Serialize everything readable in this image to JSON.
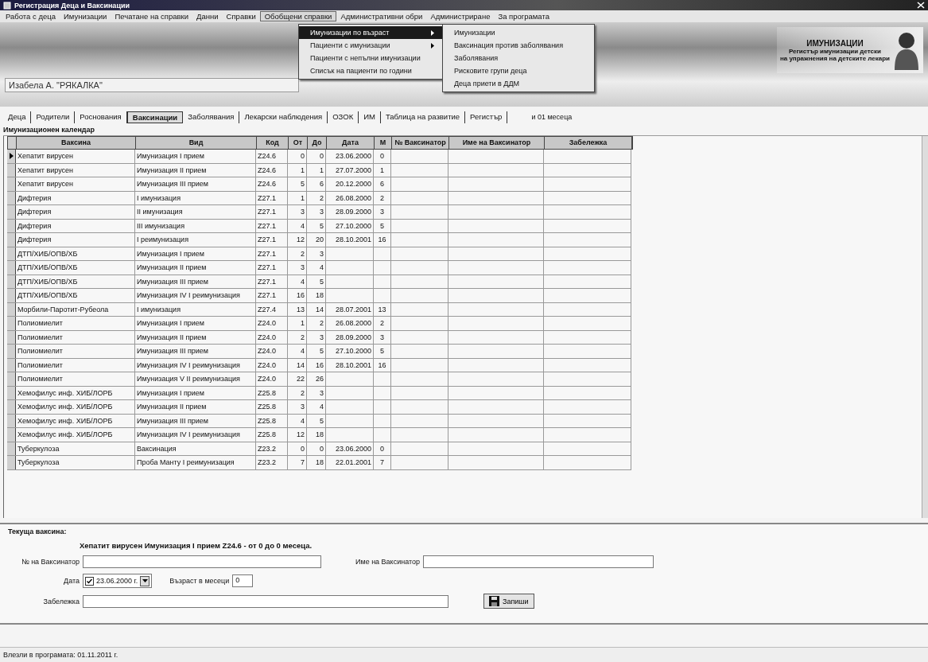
{
  "window": {
    "title": "Регистрация Деца и Ваксинации"
  },
  "menu": [
    {
      "label": "Работа с деца",
      "selected": false
    },
    {
      "label": "Имунизации",
      "selected": false
    },
    {
      "label": "Печатане на справки",
      "selected": false
    },
    {
      "label": "Данни",
      "selected": false
    },
    {
      "label": "Справки",
      "selected": false
    },
    {
      "label": "Обобщени справки",
      "selected": true
    },
    {
      "label": "Административни обри",
      "selected": false
    },
    {
      "label": "Администриране",
      "selected": false
    },
    {
      "label": "За програмата",
      "selected": false
    }
  ],
  "dropdown": {
    "items": [
      {
        "label": "Имунизации по възраст",
        "has_submenu": true,
        "selected": true
      },
      {
        "label": "Пациенти с имунизации",
        "has_submenu": true,
        "selected": false
      },
      {
        "label": "Пациенти с непълни имунизации",
        "has_submenu": false,
        "selected": false
      },
      {
        "label": "Списък на пациенти по години",
        "has_submenu": false,
        "selected": false
      }
    ],
    "submenu": [
      {
        "label": "Имунизации",
        "selected": false
      },
      {
        "label": "Ваксинация против заболявания",
        "selected": false
      },
      {
        "label": "Заболявания",
        "selected": false
      },
      {
        "label": "Рисковите групи деца",
        "selected": false
      },
      {
        "label": "Деца приети в ДДМ",
        "selected": false
      }
    ]
  },
  "logo": {
    "title": "ИМУНИЗАЦИИ",
    "lines": [
      "Регистър имунизации детски",
      "на упражнения на детските лекари"
    ]
  },
  "patient": "Изабела А. \"РЯКАЛКА\"",
  "age_note": "и 01 месеца",
  "tabs": [
    {
      "label": "Деца",
      "selected": false
    },
    {
      "label": "Родители",
      "selected": false
    },
    {
      "label": "Роснования",
      "selected": false
    },
    {
      "label": "Ваксинации",
      "selected": true
    },
    {
      "label": "Заболявания",
      "selected": false
    },
    {
      "label": "Лекарски наблюдения",
      "selected": false
    },
    {
      "label": "ОЗОК",
      "selected": false
    },
    {
      "label": "ИМ",
      "selected": false
    },
    {
      "label": "Таблица на развитие",
      "selected": false
    },
    {
      "label": "Регистър",
      "selected": false
    }
  ],
  "group_title": "Имунизационен календар",
  "table": {
    "columns": [
      "Ваксина",
      "Вид",
      "Код",
      "От",
      "До",
      "Дата",
      "М",
      "№ Ваксинатор",
      "Име на Ваксинатор",
      "Забележка"
    ],
    "rows": [
      {
        "selected": true,
        "cells": [
          "Хепатит вирусен",
          "Имунизация I прием",
          "Z24.6",
          "0",
          "0",
          "23.06.2000",
          "0"
        ]
      },
      {
        "selected": false,
        "cells": [
          "Хепатит вирусен",
          "Имунизация II прием",
          "Z24.6",
          "1",
          "1",
          "27.07.2000",
          "1"
        ]
      },
      {
        "selected": false,
        "cells": [
          "Хепатит вирусен",
          "Имунизация III прием",
          "Z24.6",
          "5",
          "6",
          "20.12.2000",
          "6"
        ]
      },
      {
        "selected": false,
        "cells": [
          "Дифтерия",
          "I имунизация",
          "Z27.1",
          "1",
          "2",
          "26.08.2000",
          "2"
        ]
      },
      {
        "selected": false,
        "cells": [
          "Дифтерия",
          "II имунизация",
          "Z27.1",
          "3",
          "3",
          "28.09.2000",
          "3"
        ]
      },
      {
        "selected": false,
        "cells": [
          "Дифтерия",
          "III имунизация",
          "Z27.1",
          "4",
          "5",
          "27.10.2000",
          "5"
        ]
      },
      {
        "selected": false,
        "cells": [
          "Дифтерия",
          "I реимунизация",
          "Z27.1",
          "12",
          "20",
          "28.10.2001",
          "16"
        ]
      },
      {
        "selected": false,
        "cells": [
          "ДТП/ХИБ/ОПВ/ХБ",
          "Имунизация I прием",
          "Z27.1",
          "2",
          "3",
          "",
          ""
        ]
      },
      {
        "selected": false,
        "cells": [
          "ДТП/ХИБ/ОПВ/ХБ",
          "Имунизация II прием",
          "Z27.1",
          "3",
          "4",
          "",
          ""
        ]
      },
      {
        "selected": false,
        "cells": [
          "ДТП/ХИБ/ОПВ/ХБ",
          "Имунизация III прием",
          "Z27.1",
          "4",
          "5",
          "",
          ""
        ]
      },
      {
        "selected": false,
        "cells": [
          "ДТП/ХИБ/ОПВ/ХБ",
          "Имунизация IV I реимунизация",
          "Z27.1",
          "16",
          "18",
          "",
          ""
        ]
      },
      {
        "selected": false,
        "cells": [
          "Морбили-Паротит-Рубеола",
          "I имунизация",
          "Z27.4",
          "13",
          "14",
          "28.07.2001",
          "13"
        ]
      },
      {
        "selected": false,
        "cells": [
          "Полиомиелит",
          "Имунизация I прием",
          "Z24.0",
          "1",
          "2",
          "26.08.2000",
          "2"
        ]
      },
      {
        "selected": false,
        "cells": [
          "Полиомиелит",
          "Имунизация II прием",
          "Z24.0",
          "2",
          "3",
          "28.09.2000",
          "3"
        ]
      },
      {
        "selected": false,
        "cells": [
          "Полиомиелит",
          "Имунизация III прием",
          "Z24.0",
          "4",
          "5",
          "27.10.2000",
          "5"
        ]
      },
      {
        "selected": false,
        "cells": [
          "Полиомиелит",
          "Имунизация IV I реимунизация",
          "Z24.0",
          "14",
          "16",
          "28.10.2001",
          "16"
        ]
      },
      {
        "selected": false,
        "cells": [
          "Полиомиелит",
          "Имунизация V II реимунизация",
          "Z24.0",
          "22",
          "26",
          "",
          ""
        ]
      },
      {
        "selected": false,
        "cells": [
          "Хемофилус инф. ХИБ/ЛОРБ",
          "Имунизация I прием",
          "Z25.8",
          "2",
          "3",
          "",
          ""
        ]
      },
      {
        "selected": false,
        "cells": [
          "Хемофилус инф. ХИБ/ЛОРБ",
          "Имунизация II прием",
          "Z25.8",
          "3",
          "4",
          "",
          ""
        ]
      },
      {
        "selected": false,
        "cells": [
          "Хемофилус инф. ХИБ/ЛОРБ",
          "Имунизация III прием",
          "Z25.8",
          "4",
          "5",
          "",
          ""
        ]
      },
      {
        "selected": false,
        "cells": [
          "Хемофилус инф. ХИБ/ЛОРБ",
          "Имунизация IV I реимунизация",
          "Z25.8",
          "12",
          "18",
          "",
          ""
        ]
      },
      {
        "selected": false,
        "cells": [
          "Туберкулоза",
          "Ваксинация",
          "Z23.2",
          "0",
          "0",
          "23.06.2000",
          "0"
        ]
      },
      {
        "selected": false,
        "cells": [
          "Туберкулоза",
          "Проба Манту I реимунизация",
          "Z23.2",
          "7",
          "18",
          "22.01.2001",
          "7"
        ]
      }
    ]
  },
  "current": {
    "title": "Текуща ваксина:",
    "description": "Хепатит вирусен Имунизация I прием Z24.6 - от 0 до 0 месеца.",
    "fields": {
      "number_label": "№ на Ваксинатор",
      "name_label": "Име на Ваксинатор",
      "date_label": "Дата",
      "date_value": "23.06.2000 г.",
      "date_checked": true,
      "age_label": "Възраст в месеци",
      "age_value": "0",
      "note_label": "Забележка"
    },
    "save_button": "Запиши"
  },
  "status_bar": "Влезли в програмата: 01.11.2011 г."
}
